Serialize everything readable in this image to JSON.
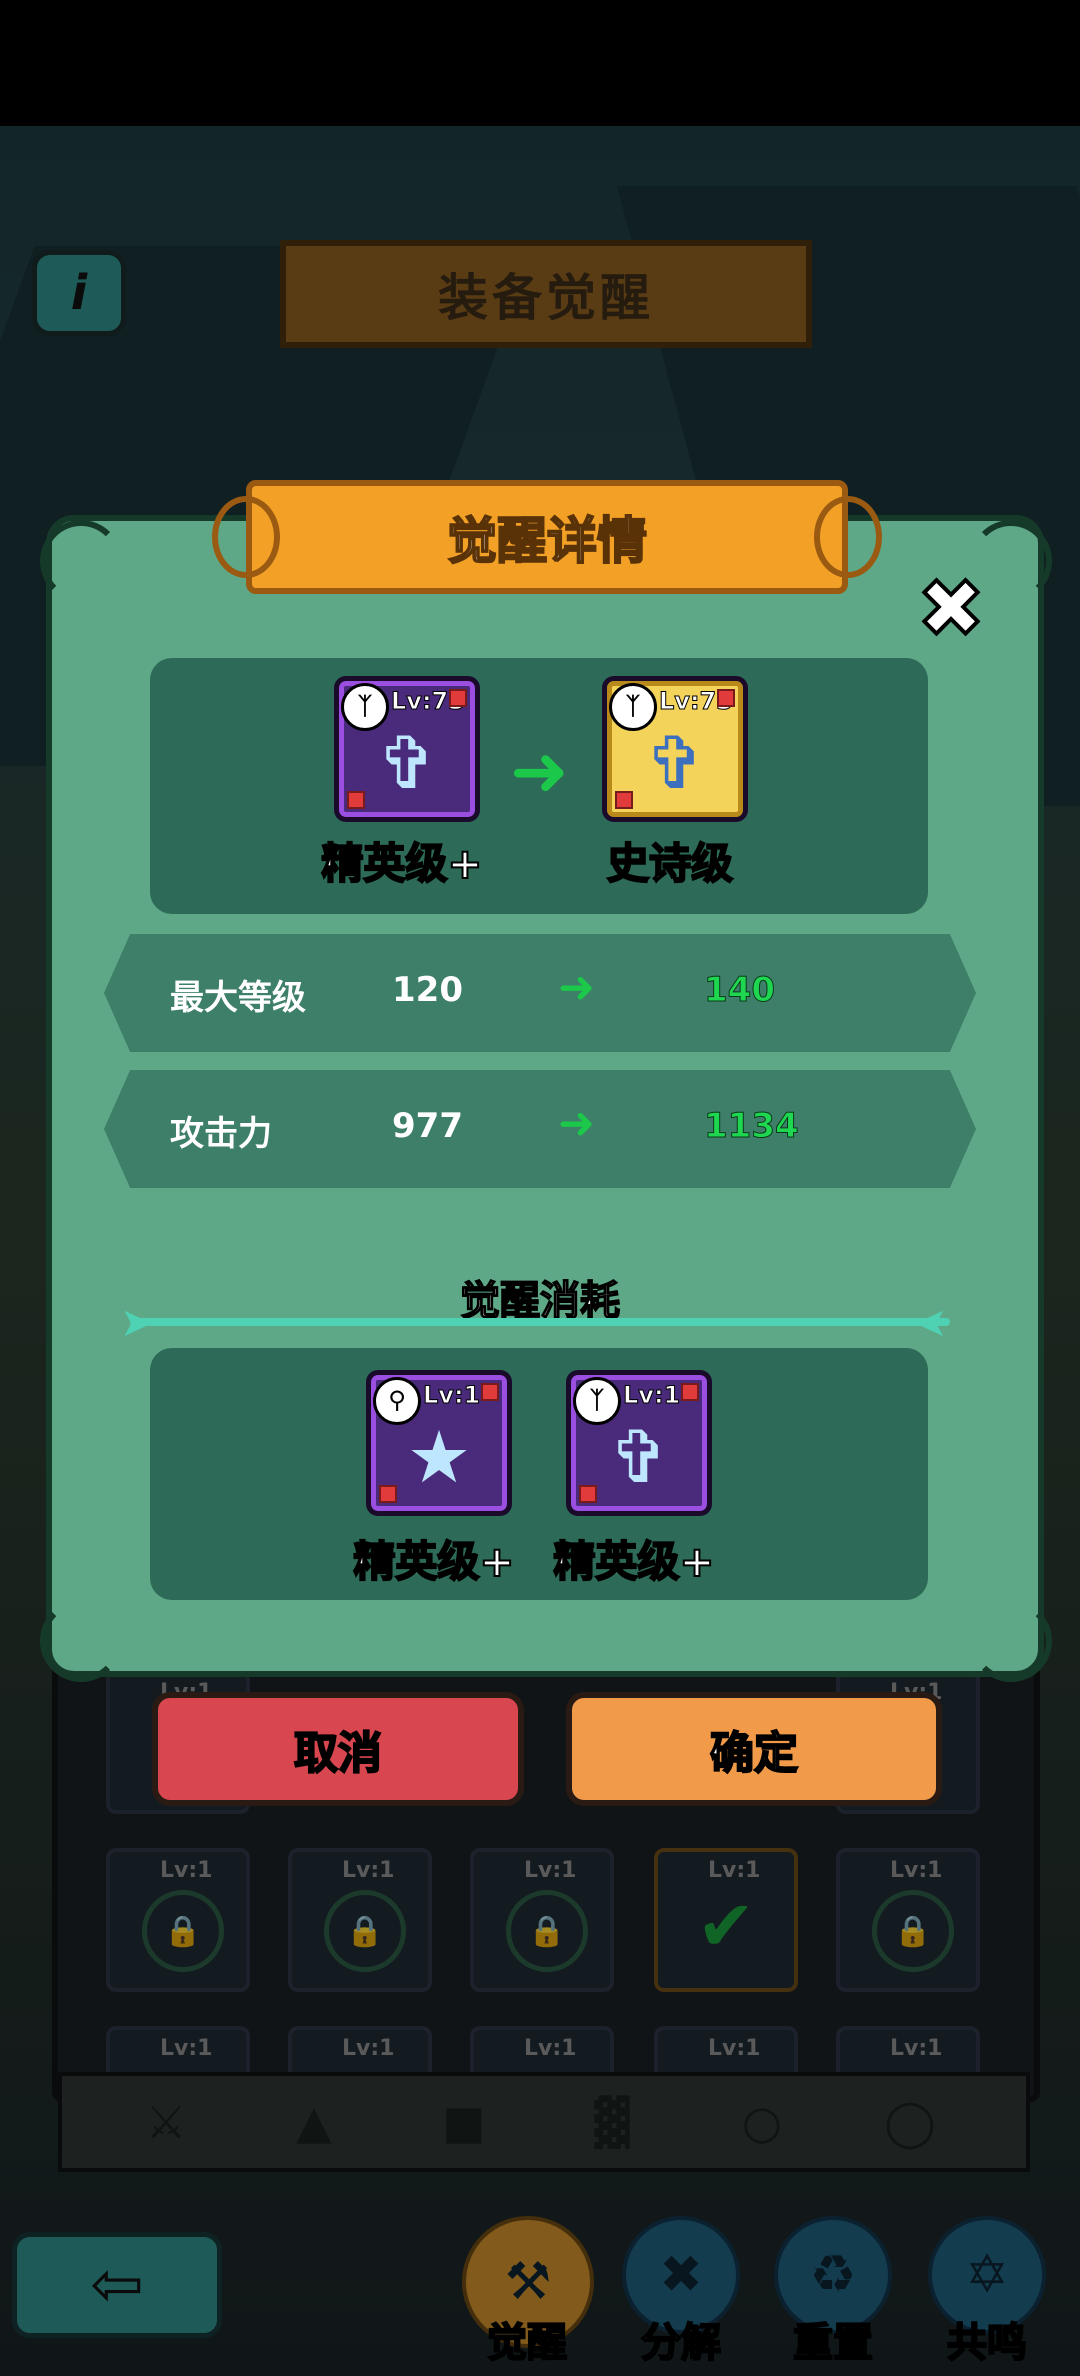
{
  "header": {
    "title": "装备觉醒",
    "info_icon": "info-icon"
  },
  "dialog": {
    "title": "觉醒详情",
    "close_icon": "close-icon",
    "from_item": {
      "level": "Lv:73",
      "grade": "精英级+",
      "icon": "bow-icon"
    },
    "to_item": {
      "level": "Lv:73",
      "grade": "史诗级",
      "icon": "bow-icon"
    },
    "stats": [
      {
        "label": "最大等级",
        "old": "120",
        "new": "140"
      },
      {
        "label": "攻击力",
        "old": "977",
        "new": "1134"
      }
    ],
    "cost_title": "觉醒消耗",
    "cost_items": [
      {
        "level": "Lv:1",
        "grade": "精英级+",
        "icon": "staff-icon"
      },
      {
        "level": "Lv:1",
        "grade": "精英级+",
        "icon": "bow-icon"
      }
    ],
    "cancel_label": "取消",
    "confirm_label": "确定"
  },
  "grid": {
    "slot_level": "Lv:1"
  },
  "bottom_nav": [
    {
      "label": "觉醒",
      "icon": "awaken-icon",
      "active": true
    },
    {
      "label": "分解",
      "icon": "dismantle-icon",
      "active": false
    },
    {
      "label": "重置",
      "icon": "reset-icon",
      "active": false
    },
    {
      "label": "共鸣",
      "icon": "resonance-icon",
      "active": false
    }
  ],
  "colors": {
    "dialog_bg": "#5ea887",
    "title_orange": "#f2a126",
    "stat_green": "#1ed650",
    "cancel_red": "#d8474f",
    "confirm_orange": "#f19a4a"
  }
}
